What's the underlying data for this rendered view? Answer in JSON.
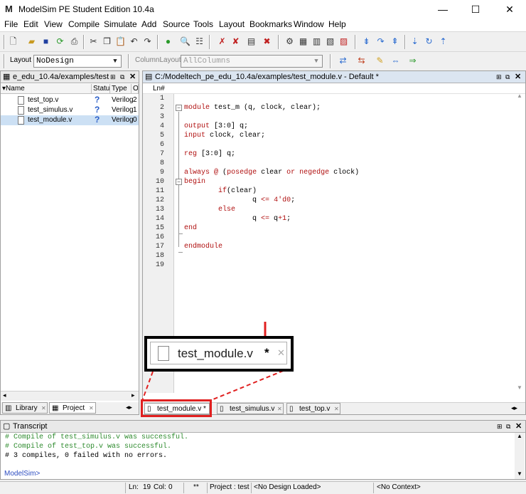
{
  "window": {
    "title": "ModelSim PE Student Edition 10.4a",
    "minimize_glyph": "—",
    "maximize_glyph": "☐",
    "close_glyph": "✕"
  },
  "menu": [
    "File",
    "Edit",
    "View",
    "Compile",
    "Simulate",
    "Add",
    "Source",
    "Tools",
    "Layout",
    "Bookmarks",
    "Window",
    "Help"
  ],
  "layout_toolbar": {
    "layout_label": "Layout",
    "layout_value": "NoDesign",
    "column_layout_label": "ColumnLayout",
    "column_layout_value": "AllColumns"
  },
  "project_pane": {
    "title": "e_edu_10.4a/examples/test",
    "columns": [
      "Name",
      "Status",
      "Type",
      "O"
    ],
    "files": [
      {
        "name": "test_top.v",
        "status": "?",
        "type": "Verilog",
        "order": "2"
      },
      {
        "name": "test_simulus.v",
        "status": "?",
        "type": "Verilog",
        "order": "1"
      },
      {
        "name": "test_module.v",
        "status": "?",
        "type": "Verilog",
        "order": "0"
      }
    ],
    "tabs": [
      "Library",
      "Project"
    ]
  },
  "editor": {
    "title": "C:/Modeltech_pe_edu_10.4a/examples/test_module.v - Default *",
    "ln_header": "Ln#",
    "lines": [
      {
        "n": "1",
        "text": ""
      },
      {
        "n": "2",
        "text": "module test_m (q, clock, clear);"
      },
      {
        "n": "3",
        "text": ""
      },
      {
        "n": "4",
        "text": "output [3:0] q;"
      },
      {
        "n": "5",
        "text": "input clock, clear;"
      },
      {
        "n": "6",
        "text": ""
      },
      {
        "n": "7",
        "text": "reg [3:0] q;"
      },
      {
        "n": "8",
        "text": ""
      },
      {
        "n": "9",
        "text": "always @ (posedge clear or negedge clock)"
      },
      {
        "n": "10",
        "text": "begin"
      },
      {
        "n": "11",
        "text": "        if(clear)"
      },
      {
        "n": "12",
        "text": "                q <= 4'd0;"
      },
      {
        "n": "13",
        "text": "        else"
      },
      {
        "n": "14",
        "text": "                q <= q+1;"
      },
      {
        "n": "15",
        "text": "end"
      },
      {
        "n": "16",
        "text": ""
      },
      {
        "n": "17",
        "text": "endmodule"
      },
      {
        "n": "18",
        "text": ""
      },
      {
        "n": "19",
        "text": ""
      }
    ],
    "tabs": [
      "test_module.v *",
      "test_simulus.v",
      "test_top.v"
    ]
  },
  "zoom_callout": {
    "tab_label": "test_module.v",
    "modified_mark": "*",
    "close_glyph": "✕",
    "highlight_color": "#e02020"
  },
  "transcript": {
    "title": "Transcript",
    "lines": [
      {
        "text": "# Compile of test_simulus.v was successful.",
        "color": "#2e8b2e"
      },
      {
        "text": "# Compile of test_top.v was successful.",
        "color": "#2e8b2e"
      },
      {
        "text": "# 3 compiles, 0 failed with no errors.",
        "color": "#000000"
      }
    ],
    "prompt": "ModelSim>"
  },
  "status_bar": {
    "ln": "Ln:",
    "ln_value": "19",
    "col": "Col:",
    "col_value": "0",
    "stars": "**",
    "project": "Project : test",
    "design": "<No Design Loaded>",
    "context": "<No Context>"
  }
}
